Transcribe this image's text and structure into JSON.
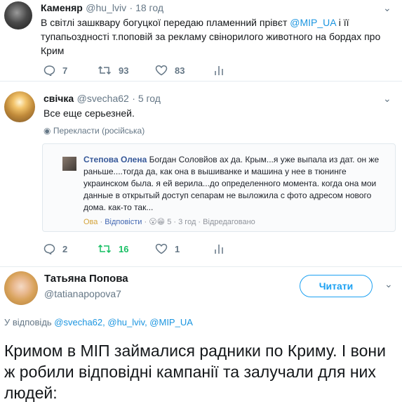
{
  "tweet1": {
    "name": "Каменяр",
    "handle": "@hu_lviv",
    "time": "· 18 год",
    "text_part1": "В світлі зашквару богуцкої передаю пламенний прівєт ",
    "mention": "@MIP_UA",
    "text_part2": " і її тупапьоздності т.поповій за рекламу свінорилого животного на бордах про Крим",
    "replies": "7",
    "retweets": "93",
    "likes": "83",
    "caret_icon": "chevron-down-icon"
  },
  "tweet2": {
    "name": "свічка",
    "handle": "@svecha62",
    "time": "· 5 год",
    "text": "Все еще серьезней.",
    "translate": "Перекласти (російська)",
    "replies": "2",
    "retweets": "16",
    "likes": "1",
    "retweet_color": "#17bf63",
    "caret_icon": "chevron-down-icon"
  },
  "embed": {
    "author": "Степова Олена",
    "text": " Богдан Соловйов ах да. Крым...я уже выпала из дат. он же раньше....тогда да, как она в вышиванке и машина у нее в тюнинге украинском была. я ей верила...до определенного момента. когда она мои данные в открытый доступ сепарам не выложила с фото адресом нового дома. как-то так...",
    "reaction_label": "Ова",
    "reply_link": "Відповісти",
    "reactions": "😮😁",
    "reaction_count": "5",
    "time": "3 год",
    "edited": "Відредаговано"
  },
  "tweet3": {
    "name": "Татьяна Попова",
    "handle": "@tatianapopova7",
    "follow_label": "Читати",
    "reply_to_prefix": "У відповідь ",
    "reply_to_users": "@svecha62, @hu_lviv, @MIP_UA",
    "text": "Кримом в МІП займалися радники по Криму. І вони ж робили відповідні кампанії та залучали для них людей:",
    "caret_icon": "chevron-down-icon"
  },
  "colors": {
    "accent": "#1da1f2",
    "link": "#1b95e0",
    "muted": "#657786",
    "retweet_active": "#17bf63"
  }
}
